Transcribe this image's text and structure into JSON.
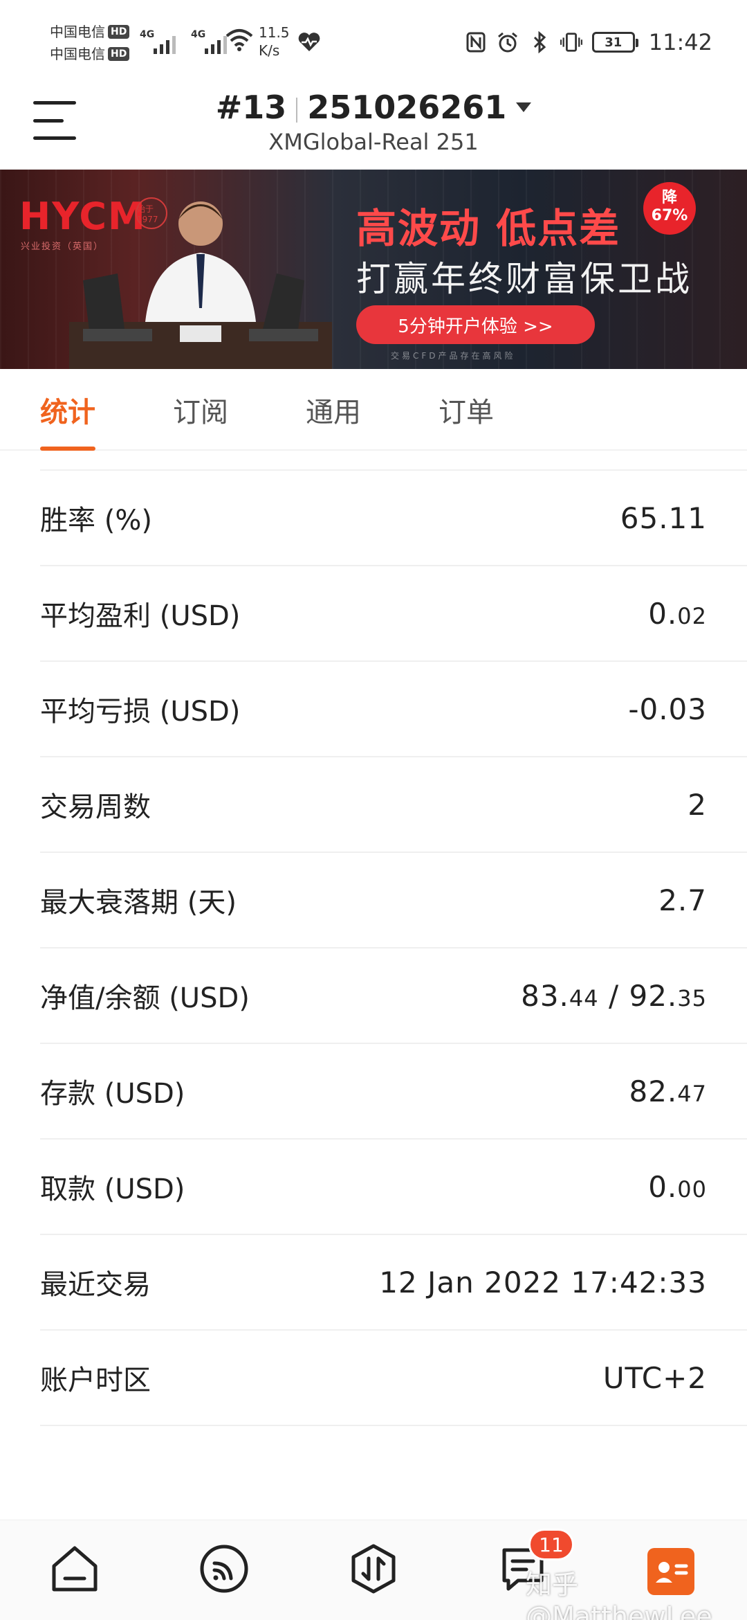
{
  "status_bar": {
    "carrier1": "中国电信",
    "carrier2": "中国电信",
    "hd": "HD",
    "net1": "4G",
    "net2": "4G",
    "speed_value": "11.5",
    "speed_unit": "K/s",
    "battery": "31",
    "time": "11:42"
  },
  "header": {
    "account_index": "#13",
    "account_number": "251026261",
    "server": "XMGlobal-Real 251"
  },
  "banner": {
    "logo": "HYCM",
    "logo_sub": "兴业投资（英国）",
    "seal": "始于1977",
    "headline": "高波动 低点差",
    "discount_line1": "降",
    "discount_line2": "67%",
    "subline": "打赢年终财富保卫战",
    "cta": "5分钟开户体验 >>",
    "disclaimer": "交易CFD产品存在高风险"
  },
  "tabs": [
    {
      "label": "统计",
      "active": true
    },
    {
      "label": "订阅",
      "active": false
    },
    {
      "label": "通用",
      "active": false
    },
    {
      "label": "订单",
      "active": false
    }
  ],
  "stats": [
    {
      "label": "胜率 (%)",
      "value_main": "65.11",
      "value_small": "",
      "value_tail": "",
      "value_tail_small": ""
    },
    {
      "label": "平均盈利 (USD)",
      "value_main": "0.",
      "value_small": "02",
      "value_tail": "",
      "value_tail_small": ""
    },
    {
      "label": "平均亏损 (USD)",
      "value_main": "-0.03",
      "value_small": "",
      "value_tail": "",
      "value_tail_small": ""
    },
    {
      "label": "交易周数",
      "value_main": "2",
      "value_small": "",
      "value_tail": "",
      "value_tail_small": ""
    },
    {
      "label": "最大衰落期 (天)",
      "value_main": "2.7",
      "value_small": "",
      "value_tail": "",
      "value_tail_small": ""
    },
    {
      "label": "净值/余额 (USD)",
      "value_main": "83.",
      "value_small": "44",
      "value_tail": " / 92.",
      "value_tail_small": "35"
    },
    {
      "label": "存款 (USD)",
      "value_main": "82.",
      "value_small": "47",
      "value_tail": "",
      "value_tail_small": ""
    },
    {
      "label": "取款 (USD)",
      "value_main": "0.",
      "value_small": "00",
      "value_tail": "",
      "value_tail_small": ""
    },
    {
      "label": "最近交易",
      "value_main": "12 Jan 2022 17:42:33",
      "value_small": "",
      "value_tail": "",
      "value_tail_small": ""
    },
    {
      "label": "账户时区",
      "value_main": "UTC+2",
      "value_small": "",
      "value_tail": "",
      "value_tail_small": ""
    }
  ],
  "bottom_nav": {
    "items": [
      "home-icon",
      "feed-icon",
      "trade-icon",
      "messages-icon",
      "profile-icon"
    ],
    "messages_badge": "11",
    "watermark": "知乎@MatthewLee"
  },
  "colors": {
    "accent": "#f0631e",
    "badge": "#f04a2e",
    "banner_red": "#e8242b"
  }
}
